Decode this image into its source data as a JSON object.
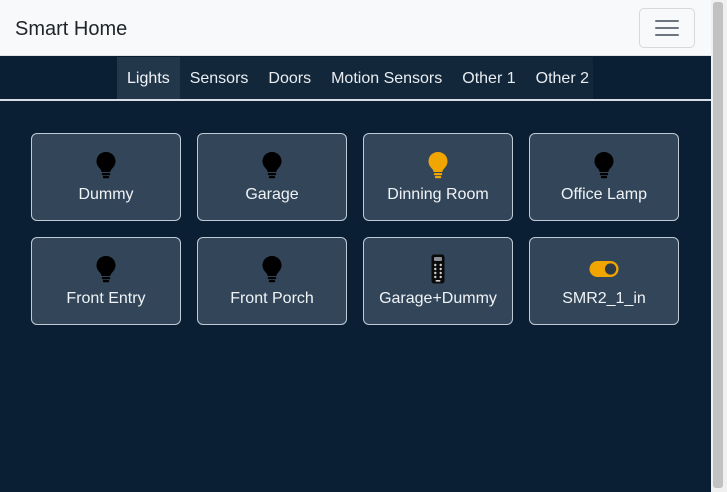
{
  "app": {
    "title": "Smart Home"
  },
  "tabs": [
    {
      "label": "Lights",
      "active": true
    },
    {
      "label": "Sensors",
      "active": false
    },
    {
      "label": "Doors",
      "active": false
    },
    {
      "label": "Motion Sensors",
      "active": false
    },
    {
      "label": "Other 1",
      "active": false
    },
    {
      "label": "Other 2",
      "active": false
    }
  ],
  "devices": [
    {
      "name": "Dummy",
      "icon": "lightbulb-icon",
      "state": "off"
    },
    {
      "name": "Garage",
      "icon": "lightbulb-icon",
      "state": "off"
    },
    {
      "name": "Dinning Room",
      "icon": "lightbulb-icon",
      "state": "on"
    },
    {
      "name": "Office Lamp",
      "icon": "lightbulb-icon",
      "state": "off"
    },
    {
      "name": "Front Entry",
      "icon": "lightbulb-icon",
      "state": "off"
    },
    {
      "name": "Front Porch",
      "icon": "lightbulb-icon",
      "state": "off"
    },
    {
      "name": "Garage+Dummy",
      "icon": "remote-icon",
      "state": "group"
    },
    {
      "name": "SMR2_1_in",
      "icon": "toggle-switch-icon",
      "state": "on"
    }
  ],
  "colors": {
    "on": "#f0a500",
    "off": "#000000",
    "page_bg": "#0a1f33",
    "tile_bg": "#334659"
  }
}
